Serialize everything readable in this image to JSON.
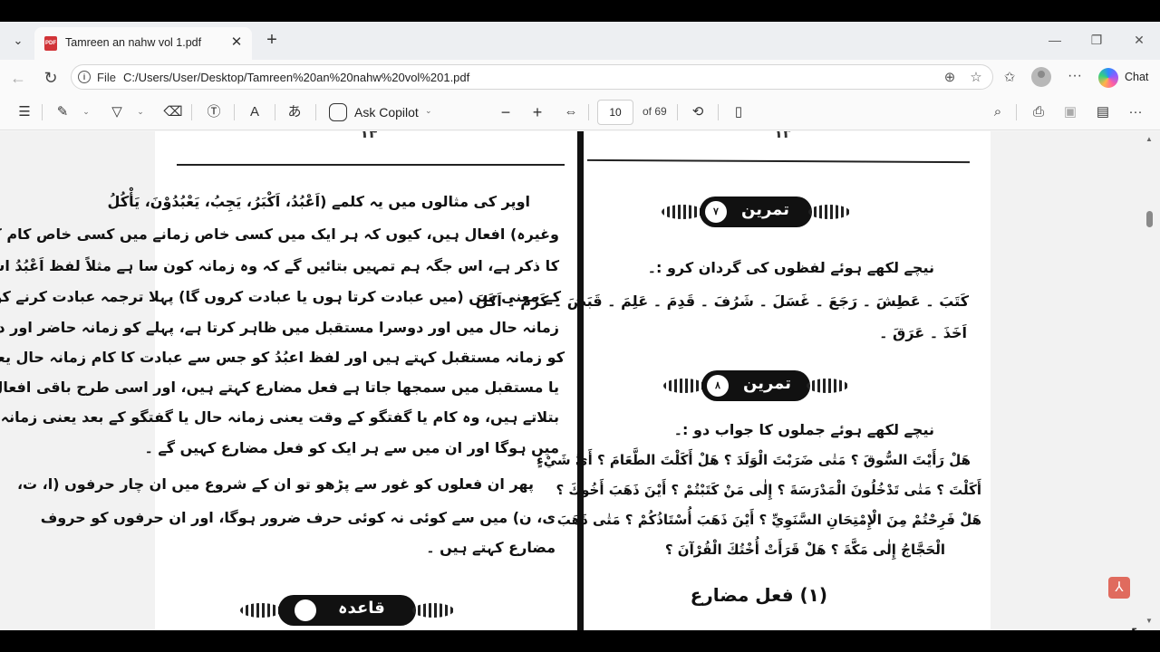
{
  "tab": {
    "title": "Tamreen an nahw vol 1.pdf"
  },
  "address": {
    "file_label": "File",
    "url": "C:/Users/User/Desktop/Tamreen%20an%20nahw%20vol%201.pdf"
  },
  "chat": {
    "label": "Chat"
  },
  "pdf_toolbar": {
    "ask_copilot": "Ask Copilot",
    "page_current": "10",
    "page_total": "of 69"
  },
  "left_page": {
    "page_number": "۱۴",
    "lines": [
      "اوپر کی مثالوں میں یہ کلمے (اَعْبُدُ، اَکْبَرُ، یَجِبُ، یَعْبُدُوْنَ، یَأْکُلُ",
      "وغیرہ) افعال ہیں، کیوں کہ ہر ایک میں کسی خاص زمانے میں کسی خاص کام کے ہونے",
      "کا ذکر ہے، اس جگہ ہم تمہیں بتائیں گے کہ وہ زمانہ کون سا ہے مثلاً لفظ اَعْبُدُ اس",
      "کے معنی ہیں (میں عبادت کرتا ہوں یا عبادت کروں گا) پہلا ترجمہ عبادت کرنے کو",
      "زمانہ حال میں اور دوسرا مستقبل میں ظاہر کرتا ہے، پہلے کو زمانہ حاضر اور دوسرے",
      "کو زمانہ مستقبل کہتے ہیں اور لفظ اعبُدُ کو جس سے عبادت کا کام زمانہ حال یعنی حاضر",
      "یا مستقبل میں سمجھا جاتا ہے فعل مضارع کہتے ہیں، اور اسی طرح باقی افعال کسی کام کو",
      "بتلاتے ہیں، وہ کام یا گفتگو کے وقت یعنی زمانہ حال یا گفتگو کے بعد یعنی زمانہ مستقبل",
      "میں ہوگا اور ان میں سے ہر ایک کو فعل مضارع کہیں گے ۔",
      "پھر ان فعلوں کو غور سے پڑھو تو ان کے شروع میں ان چار حرفوں (ا، ت،",
      "ی، ن) میں سے کوئی نہ کوئی حرف ضرور ہوگا، اور ان حرفوں کو حروف",
      "مضارع کہتے ہیں ۔"
    ],
    "banner_text": "قاعدہ"
  },
  "right_page": {
    "page_number": "۱۳",
    "banner1_number": "۷",
    "banner1_text": "تمرین",
    "instruction1": "نیچے لکھے ہوئے لفظوں کی گردان کرو :۔",
    "words": [
      "کَتَبَ ۔ عَطِشَ ۔ رَجَعَ ۔ غَسَلَ ۔ شَرُفَ ۔ قَدِمَ ۔ عَلِمَ ۔ قَبَضَ ۔ کَرُمَ ۔ اَکَلَ",
      "اَخَذَ ۔ عَرَقَ ۔"
    ],
    "banner2_number": "۸",
    "banner2_text": "تمرین",
    "instruction2": "نیچے لکھے ہوئے جملوں کا جواب دو :۔",
    "questions": [
      "هَلْ رَأَيْتَ السُّوقَ ؟ مَتٰى ضَرَبْتَ الْوَلَدَ ؟ هَلْ أَكَلْتَ الطَّعَامَ ؟ أَيَّ شَيْءٍ",
      "أَكَلْتَ ؟ مَتٰى تَدْخُلُونَ الْمَدْرَسَةَ ؟ إِلٰى مَنْ كَتَبْتُمْ ؟ أَيْنَ ذَهَبَ أَخُوكَ ؟",
      "هَلْ فَرِحْتُمْ مِنَ الْإِمْتِحَانِ السَّنَوِيِّ ؟ أَيْنَ ذَهَبَ أُسْتَاذُكُمْ ؟ مَتٰى ذَهَبَ",
      "الْحَجَّاجُ إِلٰى مَكَّةَ ؟ هَلْ قَرَأَتْ أُخْتُكَ الْقُرْآنَ ؟"
    ],
    "heading": "(۱) فعل مضارع"
  }
}
